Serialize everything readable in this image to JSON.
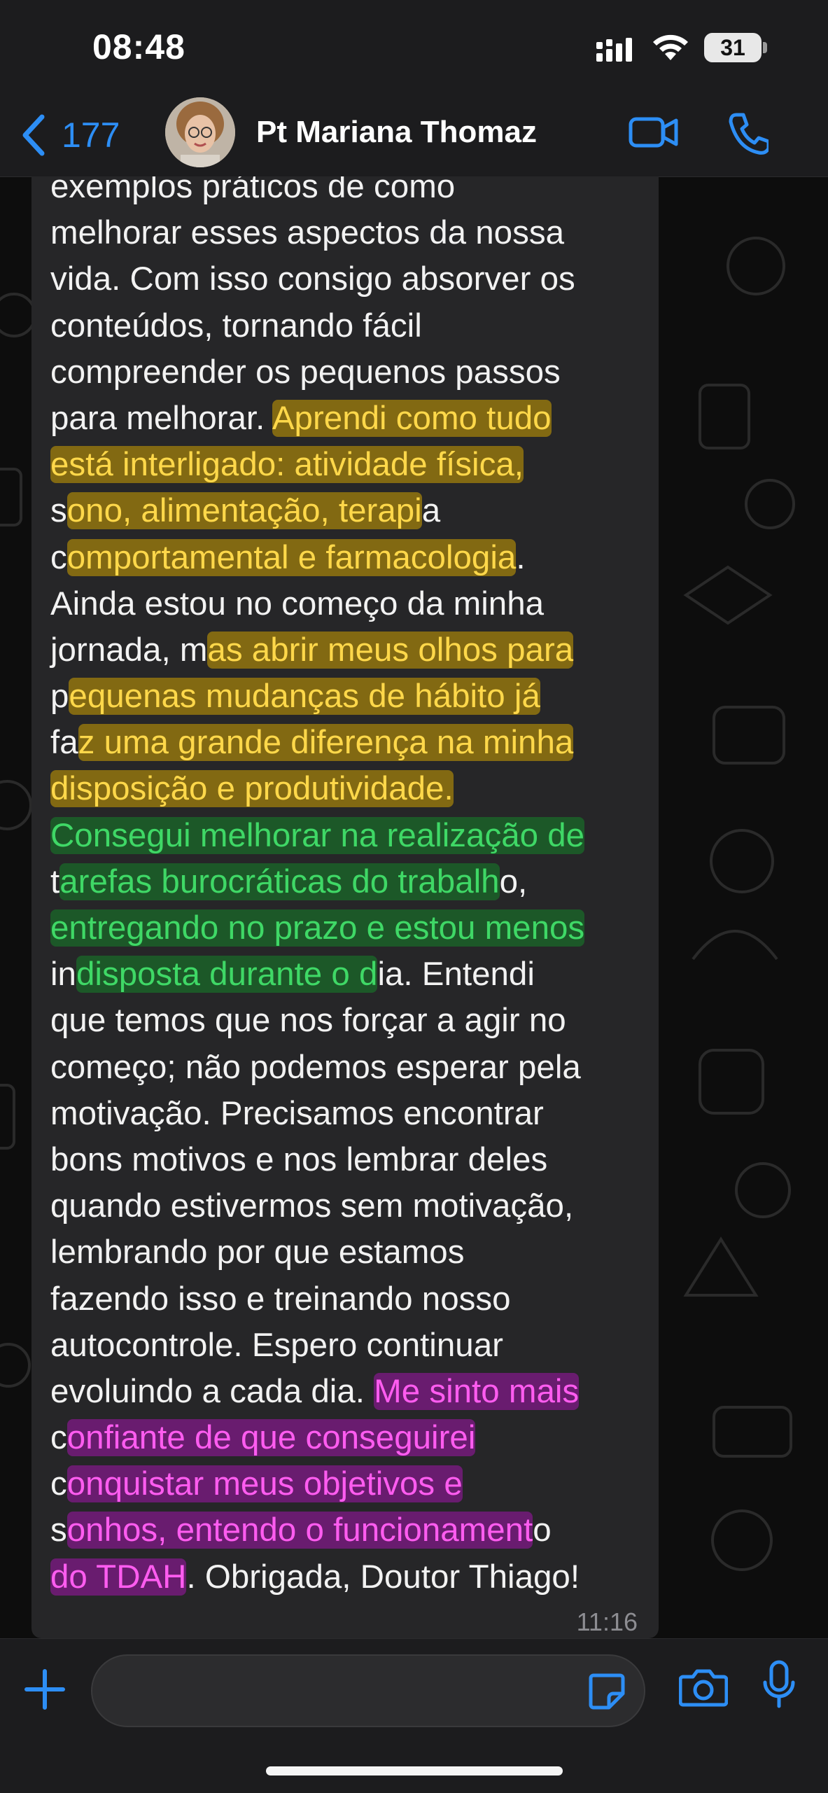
{
  "status_bar": {
    "time": "08:48",
    "battery": "31"
  },
  "header": {
    "back_count": "177",
    "contact_name": "Pt Mariana Thomaz"
  },
  "message": {
    "lines": [
      [
        {
          "t": "exemplos práticos de como"
        }
      ],
      [
        {
          "t": "melhorar esses aspectos da nossa"
        }
      ],
      [
        {
          "t": "vida. Com isso consigo absorver os"
        }
      ],
      [
        {
          "t": "conteúdos, tornando fácil"
        }
      ],
      [
        {
          "t": "compreender os pequenos passos"
        }
      ],
      [
        {
          "t": "para melhorar. "
        },
        {
          "t": "Aprendi como tudo",
          "h": "y"
        }
      ],
      [
        {
          "t": "está interligado: atividade física,",
          "h": "y"
        }
      ],
      [
        {
          "t": "s"
        },
        {
          "t": "ono, alimentação, terapi",
          "h": "y"
        },
        {
          "t": "a"
        }
      ],
      [
        {
          "t": "c"
        },
        {
          "t": "omportamental e farmacologia",
          "h": "y"
        },
        {
          "t": "."
        }
      ],
      [
        {
          "t": "Ainda estou no começo da minha"
        }
      ],
      [
        {
          "t": "jornada, m"
        },
        {
          "t": "as abrir meus olhos para",
          "h": "y"
        }
      ],
      [
        {
          "t": "p"
        },
        {
          "t": "equenas mudanças de hábito já",
          "h": "y"
        }
      ],
      [
        {
          "t": "fa"
        },
        {
          "t": "z uma grande diferença na minha",
          "h": "y"
        }
      ],
      [
        {
          "t": "disposição e produtividade.",
          "h": "y"
        }
      ],
      [
        {
          "t": "Consegui melhorar na realização de",
          "h": "g"
        }
      ],
      [
        {
          "t": "t"
        },
        {
          "t": "arefas burocráticas do trabalh",
          "h": "g"
        },
        {
          "t": "o,"
        }
      ],
      [
        {
          "t": "entregando no prazo e estou menos",
          "h": "g"
        }
      ],
      [
        {
          "t": "in"
        },
        {
          "t": "disposta durante o d",
          "h": "g"
        },
        {
          "t": "ia. Entendi"
        }
      ],
      [
        {
          "t": "que temos que nos forçar a agir no"
        }
      ],
      [
        {
          "t": "começo; não podemos esperar pela"
        }
      ],
      [
        {
          "t": "motivação. Precisamos encontrar"
        }
      ],
      [
        {
          "t": "bons motivos e nos lembrar deles"
        }
      ],
      [
        {
          "t": "quando estivermos sem motivação,"
        }
      ],
      [
        {
          "t": "lembrando por que estamos"
        }
      ],
      [
        {
          "t": "fazendo isso e treinando nosso"
        }
      ],
      [
        {
          "t": "autocontrole. Espero continuar"
        }
      ],
      [
        {
          "t": "evoluindo a cada dia. "
        },
        {
          "t": "Me sinto mais",
          "h": "p"
        }
      ],
      [
        {
          "t": "c"
        },
        {
          "t": "onfiante de que conseguirei",
          "h": "p"
        }
      ],
      [
        {
          "t": "c"
        },
        {
          "t": "onquistar meus objetivos e",
          "h": "p"
        }
      ],
      [
        {
          "t": "s"
        },
        {
          "t": "onhos, entendo o funcionament",
          "h": "p"
        },
        {
          "t": "o"
        }
      ],
      [
        {
          "t": "do TDAH",
          "h": "p"
        },
        {
          "t": ". Obrigada, Doutor Thiago!"
        }
      ]
    ],
    "time": "11:16"
  },
  "input_bar": {
    "placeholder": ""
  },
  "icons": {
    "back": "chevron-left-icon",
    "video": "video-camera-icon",
    "call": "phone-icon",
    "add": "plus-icon",
    "sticker": "sticker-icon",
    "camera": "camera-icon",
    "mic": "microphone-icon"
  },
  "colors": {
    "accent": "#2d8ef5",
    "highlight_yellow": "#ffd84a",
    "highlight_green": "#3fd866",
    "highlight_pink": "#ff5cf0",
    "bubble": "#262628"
  }
}
